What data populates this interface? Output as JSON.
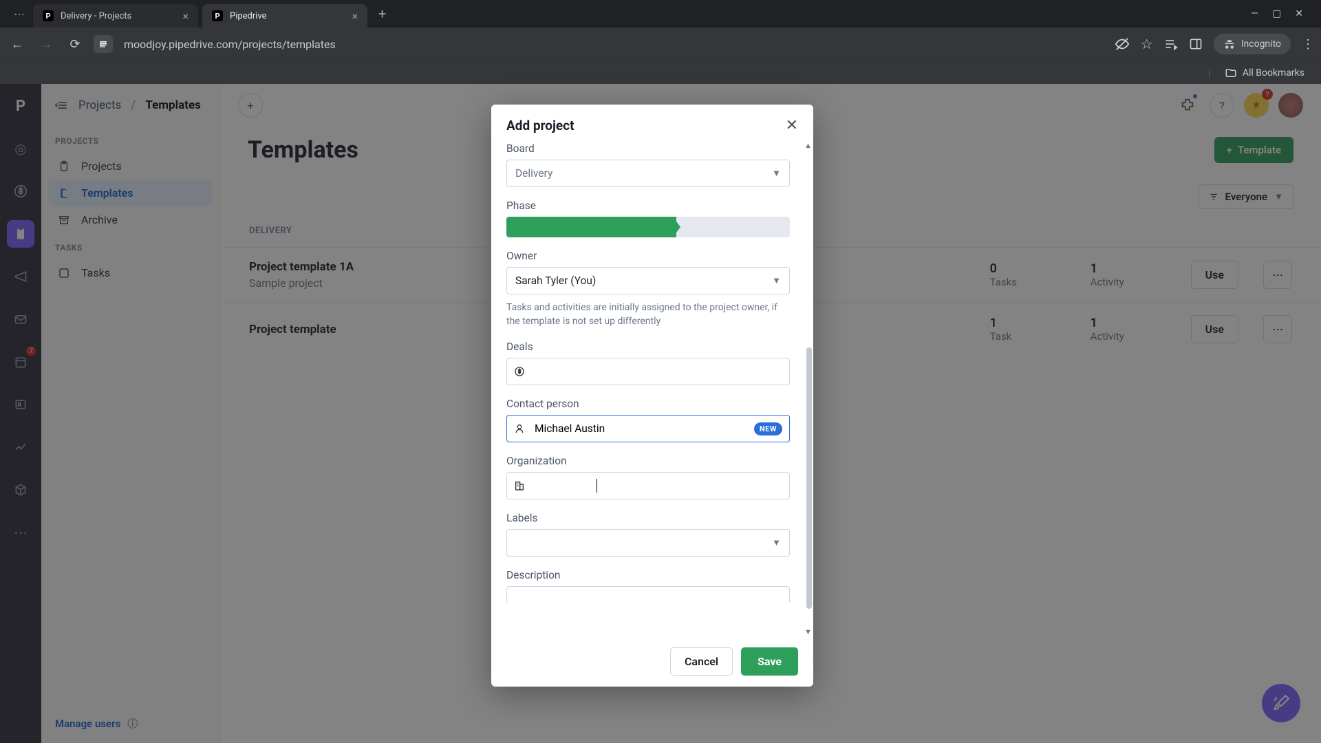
{
  "browser": {
    "tabs": [
      {
        "title": "Delivery - Projects",
        "active": false
      },
      {
        "title": "Pipedrive",
        "active": true
      }
    ],
    "url": "moodjoy.pipedrive.com/projects/templates",
    "incognito_label": "Incognito",
    "all_bookmarks": "All Bookmarks"
  },
  "rail": {
    "badge": "7"
  },
  "sidebar": {
    "breadcrumb_root": "Projects",
    "breadcrumb_sep": "/",
    "breadcrumb_leaf": "Templates",
    "section_projects": "PROJECTS",
    "items_projects": [
      {
        "label": "Projects"
      },
      {
        "label": "Templates"
      },
      {
        "label": "Archive"
      }
    ],
    "section_tasks": "TASKS",
    "items_tasks": [
      {
        "label": "Tasks"
      }
    ],
    "manage_users": "Manage users"
  },
  "main": {
    "heading": "Templates",
    "template_btn": "Template",
    "filter_everyone": "Everyone",
    "section_delivery": "DELIVERY",
    "rows": [
      {
        "name": "Project template 1A",
        "sub": "Sample project",
        "stat1_num": "0",
        "stat1_lbl": "Tasks",
        "stat2_num": "1",
        "stat2_lbl": "Activity",
        "use": "Use"
      },
      {
        "name": "Project template",
        "sub": "",
        "stat1_num": "1",
        "stat1_lbl": "Task",
        "stat2_num": "1",
        "stat2_lbl": "Activity",
        "use": "Use"
      }
    ]
  },
  "modal": {
    "title": "Add project",
    "board_label": "Board",
    "board_value": "Delivery",
    "phase_label": "Phase",
    "owner_label": "Owner",
    "owner_value": "Sarah Tyler (You)",
    "owner_help": "Tasks and activities are initially assigned to the project owner, if the template is not set up differently",
    "deals_label": "Deals",
    "contact_label": "Contact person",
    "contact_value": "Michael Austin",
    "contact_new": "NEW",
    "org_label": "Organization",
    "labels_label": "Labels",
    "description_label": "Description",
    "cancel": "Cancel",
    "save": "Save"
  }
}
